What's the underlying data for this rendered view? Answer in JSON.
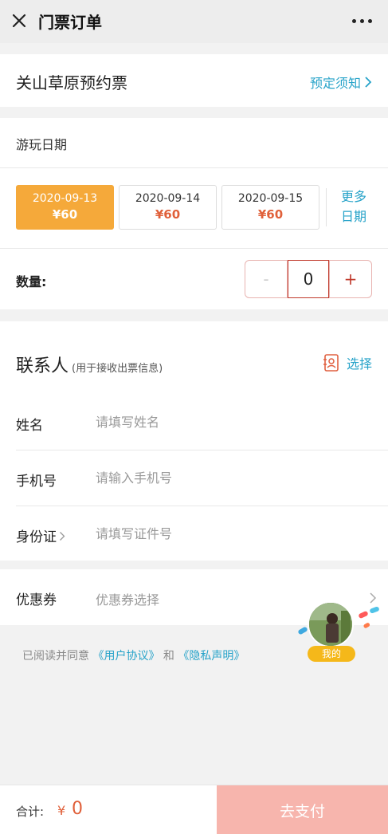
{
  "topbar": {
    "title": "门票订单",
    "close_icon": "close-icon",
    "more_icon": "more-dots-icon"
  },
  "ticket": {
    "name": "关山草原预约票",
    "notice_link": "预定须知"
  },
  "date_section": {
    "label": "游玩日期",
    "dates": [
      {
        "date": "2020-09-13",
        "price": "¥60",
        "selected": true
      },
      {
        "date": "2020-09-14",
        "price": "¥60",
        "selected": false
      },
      {
        "date": "2020-09-15",
        "price": "¥60",
        "selected": false
      }
    ],
    "more_dates": "更多日期"
  },
  "quantity": {
    "label": "数量:",
    "minus": "-",
    "value": "0",
    "plus": "+"
  },
  "contact": {
    "title": "联系人",
    "hint": "(用于接收出票信息)",
    "choose_label": "选择",
    "fields": [
      {
        "label": "姓名",
        "placeholder": "请填写姓名"
      },
      {
        "label": "手机号",
        "placeholder": "请输入手机号"
      },
      {
        "label": "身份证",
        "placeholder": "请填写证件号"
      }
    ]
  },
  "coupon": {
    "label": "优惠券",
    "placeholder": "优惠券选择"
  },
  "agreement": {
    "prefix": "已阅读并同意",
    "user_agreement": "《用户协议》",
    "and": "和",
    "privacy": "《隐私声明》"
  },
  "floating": {
    "badge": "我的"
  },
  "bottom": {
    "total_label": "合计:",
    "currency": "¥",
    "total_value": "0",
    "pay_button": "去支付"
  },
  "colors": {
    "accent_blue": "#27a3c9",
    "selected_orange": "#f5a93a",
    "price_red": "#e0603a",
    "pay_pink": "#f7b5ad"
  }
}
